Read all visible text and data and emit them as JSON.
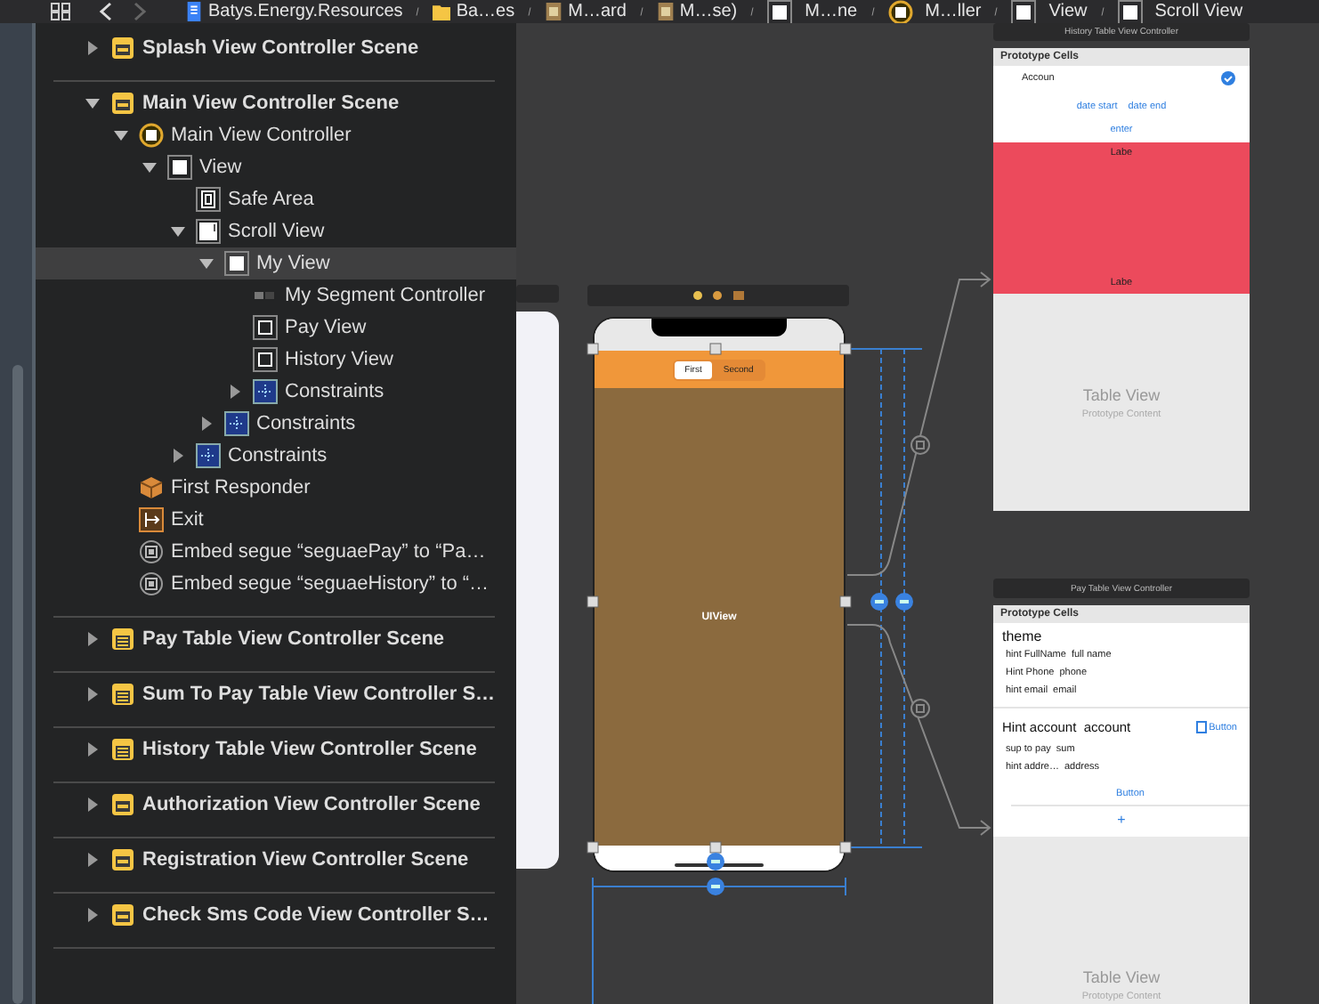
{
  "breadcrumbs": [
    {
      "label": "Batys.Energy.Resources",
      "kind": "file"
    },
    {
      "label": "Ba…es",
      "kind": "folder"
    },
    {
      "label": "M…ard",
      "kind": "storyboard"
    },
    {
      "label": "M…se)",
      "kind": "storyboard"
    },
    {
      "label": "M…ne",
      "kind": "view"
    },
    {
      "label": "M…ller",
      "kind": "controller"
    },
    {
      "label": "View",
      "kind": "view"
    },
    {
      "label": "Scroll View",
      "kind": "view"
    }
  ],
  "outline": [
    {
      "label": "Splash View Controller Scene",
      "kind": "scene",
      "expanded": false,
      "selected": false
    },
    {
      "label": "Main View Controller Scene",
      "kind": "scene",
      "expanded": true,
      "selected": false,
      "children": [
        {
          "label": "Main View Controller",
          "kind": "controller",
          "expanded": true,
          "selected": false,
          "children": [
            {
              "label": "View",
              "kind": "view",
              "expanded": true,
              "selected": false,
              "children": [
                {
                  "label": "Safe Area",
                  "kind": "safe-area",
                  "selected": false
                },
                {
                  "label": "Scroll View",
                  "kind": "scroll-view",
                  "expanded": true,
                  "selected": false,
                  "children": [
                    {
                      "label": "My View",
                      "kind": "view",
                      "expanded": true,
                      "selected": true,
                      "children": [
                        {
                          "label": "My Segment Controller",
                          "kind": "segment",
                          "selected": false
                        },
                        {
                          "label": "Pay View",
                          "kind": "outline-view",
                          "selected": false
                        },
                        {
                          "label": "History View",
                          "kind": "outline-view",
                          "selected": false
                        },
                        {
                          "label": "Constraints",
                          "kind": "constraints",
                          "expanded": false,
                          "selected": false
                        }
                      ]
                    },
                    {
                      "label": "Constraints",
                      "kind": "constraints",
                      "expanded": false,
                      "selected": false
                    }
                  ]
                },
                {
                  "label": "Constraints",
                  "kind": "constraints",
                  "expanded": false,
                  "selected": false
                }
              ]
            }
          ]
        },
        {
          "label": "First Responder",
          "kind": "responder",
          "selected": false
        },
        {
          "label": "Exit",
          "kind": "exit",
          "selected": false
        },
        {
          "label": "Embed segue “seguaePay” to “Pa…",
          "kind": "segue",
          "selected": false
        },
        {
          "label": "Embed segue “seguaeHistory” to “…",
          "kind": "segue",
          "selected": false
        }
      ]
    },
    {
      "label": "Pay Table View Controller Scene",
      "kind": "table-scene",
      "expanded": false,
      "selected": false
    },
    {
      "label": "Sum To Pay Table View Controller S…",
      "kind": "table-scene",
      "expanded": false,
      "selected": false
    },
    {
      "label": "History Table View Controller Scene",
      "kind": "table-scene",
      "expanded": false,
      "selected": false
    },
    {
      "label": "Authorization View Controller Scene",
      "kind": "scene",
      "expanded": false,
      "selected": false
    },
    {
      "label": "Registration View Controller Scene",
      "kind": "scene",
      "expanded": false,
      "selected": false
    },
    {
      "label": "Check Sms Code View Controller S…",
      "kind": "scene",
      "expanded": false,
      "selected": false
    }
  ],
  "main_scene": {
    "segments": [
      {
        "label": "First",
        "selected": true
      },
      {
        "label": "Second",
        "selected": false
      }
    ],
    "view_label": "UIView"
  },
  "history_scene": {
    "title": "History Table View Controller",
    "section": "Prototype Cells",
    "account": "Accoun",
    "date_start": "date start",
    "date_end": "date end",
    "enter": "enter",
    "labels": [
      "Labe",
      "Labe"
    ],
    "table_title": "Table View",
    "table_subtitle": "Prototype Content"
  },
  "pay_scene": {
    "title": "Pay Table View Controller",
    "section": "Prototype Cells",
    "theme": "theme",
    "hints": [
      {
        "hint": "hint FullName",
        "value": "full name"
      },
      {
        "hint": "Hint Phone",
        "value": "phone"
      },
      {
        "hint": "hint email",
        "value": "email"
      }
    ],
    "account_hint": "Hint account",
    "account_value": "account",
    "account_button": "Button",
    "rows": [
      {
        "hint": "sup to pay",
        "value": "sum"
      },
      {
        "hint": "hint addre…",
        "value": "address"
      }
    ],
    "button": "Button",
    "plus": "+",
    "table_title": "Table View",
    "table_subtitle": "Prototype Content"
  }
}
